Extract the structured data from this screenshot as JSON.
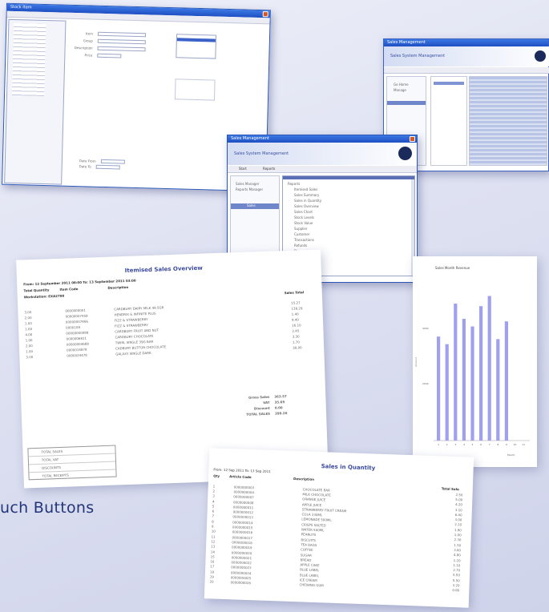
{
  "tagline": "uch Buttons",
  "win1": {
    "title": "Stock Item",
    "fields": [
      "Item",
      "Group",
      "Description",
      "Price"
    ],
    "bottom_labels": [
      "Date From",
      "Date To"
    ]
  },
  "win2": {
    "title": "Sales Management",
    "banner": "Sales System Management",
    "tabs": [
      "Start",
      "Reports"
    ],
    "left_items": [
      "Go Home",
      "Manage"
    ],
    "panel_title": "Sales"
  },
  "win3": {
    "title": "Sales Management",
    "banner": "Sales System Management",
    "tabs": [
      "Start",
      "Reports"
    ],
    "left_items": [
      "Sales Manager",
      "Reports Manager"
    ],
    "panel_title": "Sales",
    "tree": [
      "Reports",
      "Itemised Sales",
      "Sales Summary",
      "Sales in Quantity",
      "Sales Overview",
      "Sales Chart",
      "Stock Levels",
      "Stock Value",
      "Supplier",
      "Customer",
      "Transactions",
      "Refunds",
      "Discounts",
      "Tax"
    ]
  },
  "report1": {
    "title": "Itemised Sales Overview",
    "from_to": "From: 12 September 2011 08:00 To: 13 September 2011 03:00",
    "headers": [
      "Total Quantity",
      "Item Code",
      "Description",
      "Sales Total"
    ],
    "group": "Workstation: EXA2700",
    "rows": [
      [
        "3.00",
        "0000000001",
        "CARDBURY DAIRY MILK 49.5GR",
        "15.27"
      ],
      [
        "2.00",
        "00000007458",
        "HENDRIX & INFINITE PLUS",
        "138.29"
      ],
      [
        "1.00",
        "00000007466",
        "FIZZ & STRAWBERRY",
        "1.40"
      ],
      [
        "1.00",
        "0000108",
        "FIZZ & STRAWBERRY",
        "9.40"
      ],
      [
        "4.00",
        "00000000088",
        "CARDBURY FRUIT AND NUT",
        "16.10"
      ],
      [
        "1.00",
        "0000006811",
        "CARDBURY CHOCOLATE",
        "2.45"
      ],
      [
        "2.00",
        "00000004688",
        "TWIRL SINGLE 39G BAR",
        "3.30"
      ],
      [
        "1.00",
        "0000014878",
        "CADBURY BUTTON CHOCOLATE",
        "1.70"
      ],
      [
        "3.00",
        "0000024478",
        "GALAXY SINGLE DARK",
        "39.00"
      ]
    ],
    "totals_labels": [
      "Gross Sales",
      "VAT",
      "Discount",
      "TOTAL SALES"
    ],
    "totals_values": [
      "363.57",
      "35.69",
      "0.00",
      "399.26"
    ],
    "small_table": [
      "TOTAL SALES",
      "TOTAL VAT",
      "DISCOUNTS",
      "TOTAL RECEIPTS"
    ]
  },
  "report2": {
    "title": "Sales in Quantity",
    "from_to": "From: 12 Sep 2011 To: 13 Sep 2011",
    "headers": [
      "Qty",
      "Article Code",
      "Description",
      "Total Sale"
    ],
    "rows": [
      [
        "1",
        "0000000003",
        "CHOCOLATE BAR",
        "2.50"
      ],
      [
        "2",
        "0000000004",
        "MILK CHOCOLATE",
        "5.00"
      ],
      [
        "3",
        "0000000007",
        "ORANGE JUICE",
        "4.20"
      ],
      [
        "4",
        "0000000008",
        "APPLE JUICE",
        "3.10"
      ],
      [
        "5",
        "0000000011",
        "STRAWBERRY FRUIT CREAM",
        "6.40"
      ],
      [
        "6",
        "0000000012",
        "COLA 330ML",
        "3.00"
      ],
      [
        "7",
        "0000000013",
        "LEMONADE 500ML",
        "2.10"
      ],
      [
        "8",
        "0000000014",
        "CRISPS SALTED",
        "1.90"
      ],
      [
        "9",
        "0000000015",
        "WATER 500ML",
        "1.00"
      ],
      [
        "10",
        "0000000016",
        "PEANUTS",
        "2.30"
      ],
      [
        "11",
        "0000000017",
        "BISCUITS",
        "1.50"
      ],
      [
        "12",
        "0000000018",
        "TEA BAGS",
        "3.60"
      ],
      [
        "13",
        "0000000019",
        "COFFEE",
        "4.80"
      ],
      [
        "14",
        "0000000020",
        "SUGAR",
        "1.20"
      ],
      [
        "15",
        "0000000021",
        "BREAD",
        "1.10"
      ],
      [
        "16",
        "0000000022",
        "APPLE CAKE",
        "2.70"
      ],
      [
        "17",
        "0000000023",
        "BLUE LABEL",
        "5.50"
      ],
      [
        "18",
        "0000000024",
        "BLUE LABEL",
        "5.50"
      ],
      [
        "19",
        "0000000025",
        "ICE CREAM",
        "3.20"
      ],
      [
        "20",
        "0000000026",
        "CHEWING GUM",
        "0.80"
      ]
    ]
  },
  "chart": {
    "title": "Sales Month Revenue",
    "xlabel": "Month",
    "ylabel": "Amount",
    "ticks": [
      "4000",
      "2000"
    ]
  },
  "chart_data": {
    "type": "bar",
    "categories": [
      "1",
      "2",
      "3",
      "4",
      "5",
      "6",
      "7",
      "8",
      "9",
      "10",
      "11"
    ],
    "values": [
      4100,
      3800,
      5400,
      4800,
      4500,
      5300,
      5700,
      4000,
      4700,
      0,
      0
    ],
    "title": "Sales Month Revenue",
    "xlabel": "Month",
    "ylabel": "Amount",
    "ylim": [
      0,
      6000
    ],
    "color": "#9fa0ee"
  }
}
